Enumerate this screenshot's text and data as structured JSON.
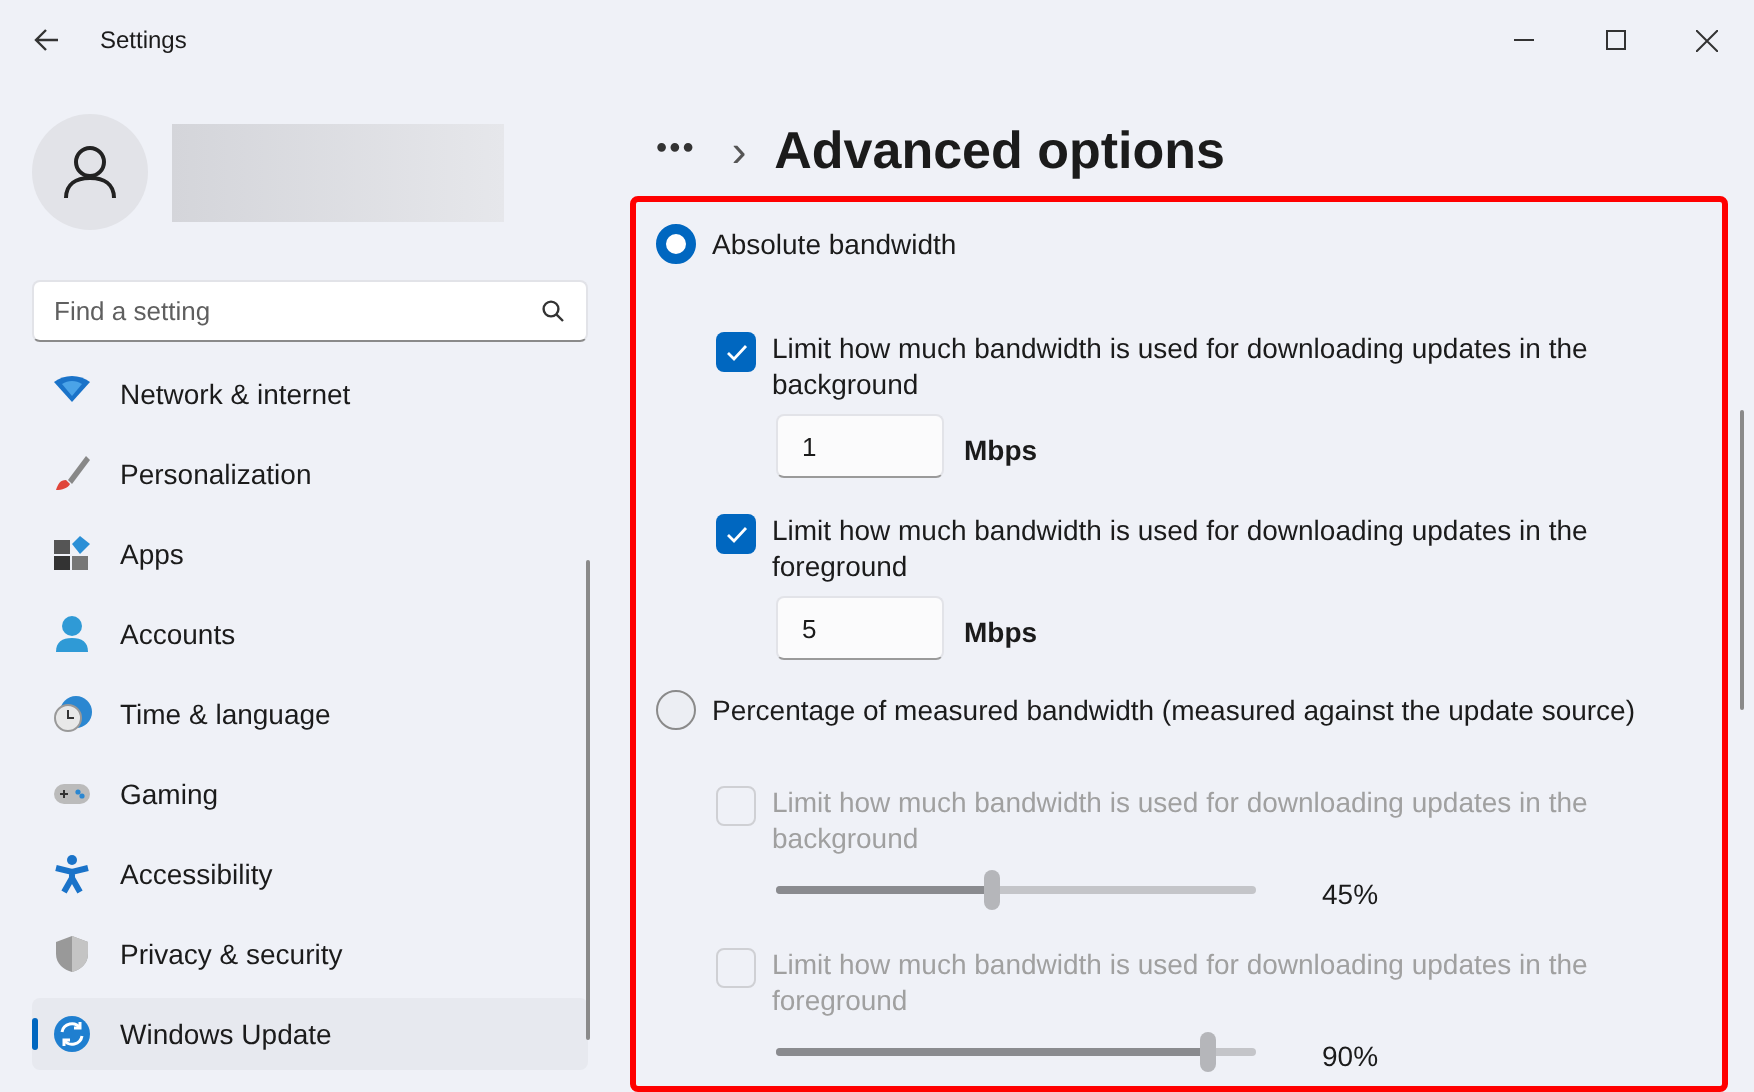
{
  "window": {
    "title": "Settings"
  },
  "search": {
    "placeholder": "Find a setting"
  },
  "sidebar": {
    "items": [
      {
        "label": "Network & internet",
        "selected": false
      },
      {
        "label": "Personalization",
        "selected": false
      },
      {
        "label": "Apps",
        "selected": false
      },
      {
        "label": "Accounts",
        "selected": false
      },
      {
        "label": "Time & language",
        "selected": false
      },
      {
        "label": "Gaming",
        "selected": false
      },
      {
        "label": "Accessibility",
        "selected": false
      },
      {
        "label": "Privacy & security",
        "selected": false
      },
      {
        "label": "Windows Update",
        "selected": true
      }
    ]
  },
  "breadcrumb": {
    "more": "•••",
    "separator": "›",
    "title": "Advanced options"
  },
  "options_panel": {
    "highlighted": true,
    "groups": [
      {
        "label": "Absolute bandwidth",
        "selected": true,
        "rows": [
          {
            "kind": "number",
            "label": "Limit how much bandwidth is used for downloading updates in the background",
            "checked": true,
            "disabled": false,
            "value": "1",
            "unit": "Mbps"
          },
          {
            "kind": "number",
            "label": "Limit how much bandwidth is used for downloading updates in the foreground",
            "checked": true,
            "disabled": false,
            "value": "5",
            "unit": "Mbps"
          }
        ]
      },
      {
        "label": "Percentage of measured bandwidth (measured against the update source)",
        "selected": false,
        "rows": [
          {
            "kind": "slider",
            "label": "Limit how much bandwidth is used for downloading updates in the background",
            "checked": false,
            "disabled": true,
            "level": 0.45,
            "reading": "45%"
          },
          {
            "kind": "slider",
            "label": "Limit how much bandwidth is used for downloading updates in the foreground",
            "checked": false,
            "disabled": true,
            "level": 0.9,
            "reading": "90%"
          }
        ]
      }
    ]
  }
}
